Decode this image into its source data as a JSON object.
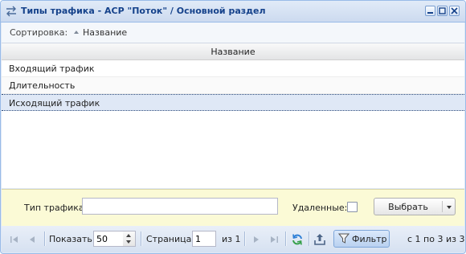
{
  "window": {
    "title": "Типы трафика - АСР \"Поток\" / Основной раздел"
  },
  "sortbar": {
    "label": "Сортировка:",
    "item": "Название"
  },
  "grid": {
    "column_header": "Название",
    "rows": [
      "Входящий трафик",
      "Длительность",
      "Исходящий трафик"
    ],
    "selected_index": 2
  },
  "filter": {
    "type_label": "Тип трафика:",
    "type_value": "",
    "deleted_label": "Удаленные:",
    "deleted_checked": false,
    "select_button": "Выбрать"
  },
  "pager": {
    "show_label": "Показать",
    "page_size": "50",
    "page_label": "Страница",
    "page_value": "1",
    "of_pages": "из 1",
    "filter_button": "Фильтр",
    "summary": "с 1 по 3 из 3"
  },
  "icons": [
    "exchange-arrows-icon",
    "minimize-icon",
    "maximize-icon",
    "close-icon",
    "first-page-icon",
    "prev-page-icon",
    "next-page-icon",
    "last-page-icon",
    "refresh-icon",
    "export-icon",
    "filter-icon"
  ]
}
